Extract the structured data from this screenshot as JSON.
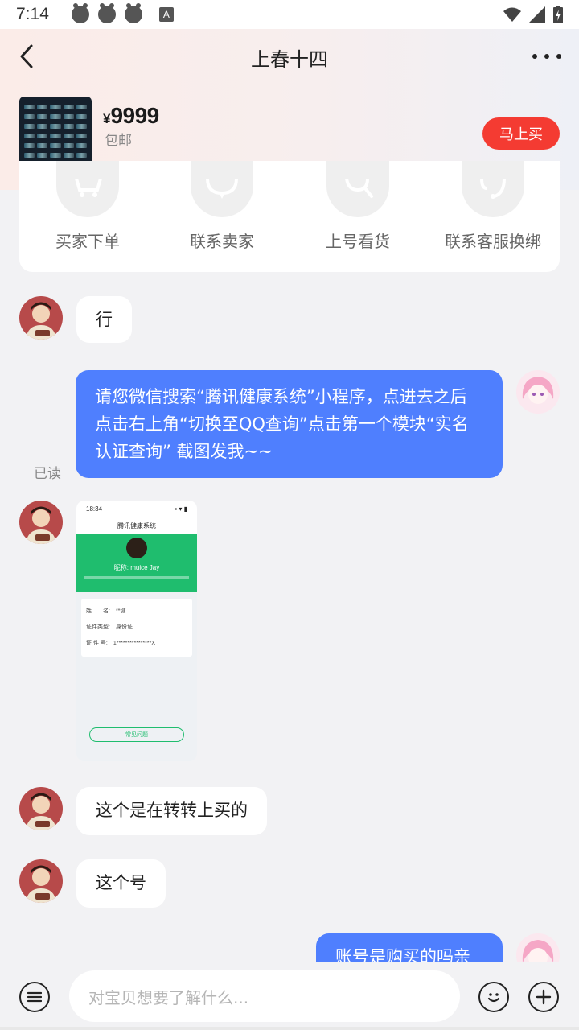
{
  "status": {
    "time": "7:14"
  },
  "header": {
    "title": "上春十四"
  },
  "product": {
    "currency": "¥",
    "price": "9999",
    "shipping": "包邮",
    "buy_label": "马上买"
  },
  "actions": [
    {
      "label": "买家下单",
      "icon": "cart-icon"
    },
    {
      "label": "联系卖家",
      "icon": "chat-icon"
    },
    {
      "label": "上号看货",
      "icon": "magnifier-icon"
    },
    {
      "label": "联系客服换绑",
      "icon": "headset-icon"
    }
  ],
  "messages": {
    "m1": "行",
    "m2": "请您微信搜索“腾讯健康系统”小程序，点进去之后点击右上角“切换至QQ查询”点击第一个模块“实名认证查询” 截图发我~~",
    "read": "已读",
    "m4": "这个是在转转上买的",
    "m5": "这个号",
    "m6": "账号是购买的吗亲"
  },
  "screenshot": {
    "time": "18:34",
    "title": "腾讯健康系统",
    "nickname": "昵称: muice Jay",
    "rows": [
      "姓　　名:　**健",
      "证件类型:　身份证",
      "证  件  号:　1****************X"
    ],
    "button": "常见问题"
  },
  "composer": {
    "placeholder": "对宝贝想要了解什么..."
  },
  "colors": {
    "accent": "#4f7ffe",
    "buy": "#f43b32",
    "green": "#1fbd6e"
  }
}
